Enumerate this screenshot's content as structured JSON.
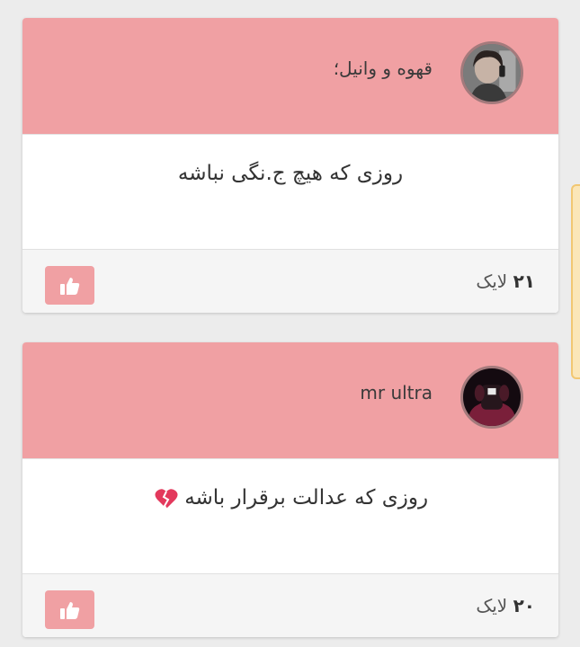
{
  "posts": [
    {
      "author": "قهوه و وانیل؛",
      "text": "روزی که هیچ ج.نگی نباشه",
      "like_number": "۲۱",
      "like_label": "لایک"
    },
    {
      "author": "mr ultra",
      "text": "روزی که عدالت برقرار باشه",
      "like_number": "۲۰",
      "like_label": "لایک"
    }
  ],
  "colors": {
    "header": "#f0a0a3",
    "footer": "#f5f5f5",
    "side_tab": "#fbe6b8"
  },
  "icons": {
    "like_button": "thumbs-up-icon",
    "emoji": "broken-heart-icon"
  }
}
